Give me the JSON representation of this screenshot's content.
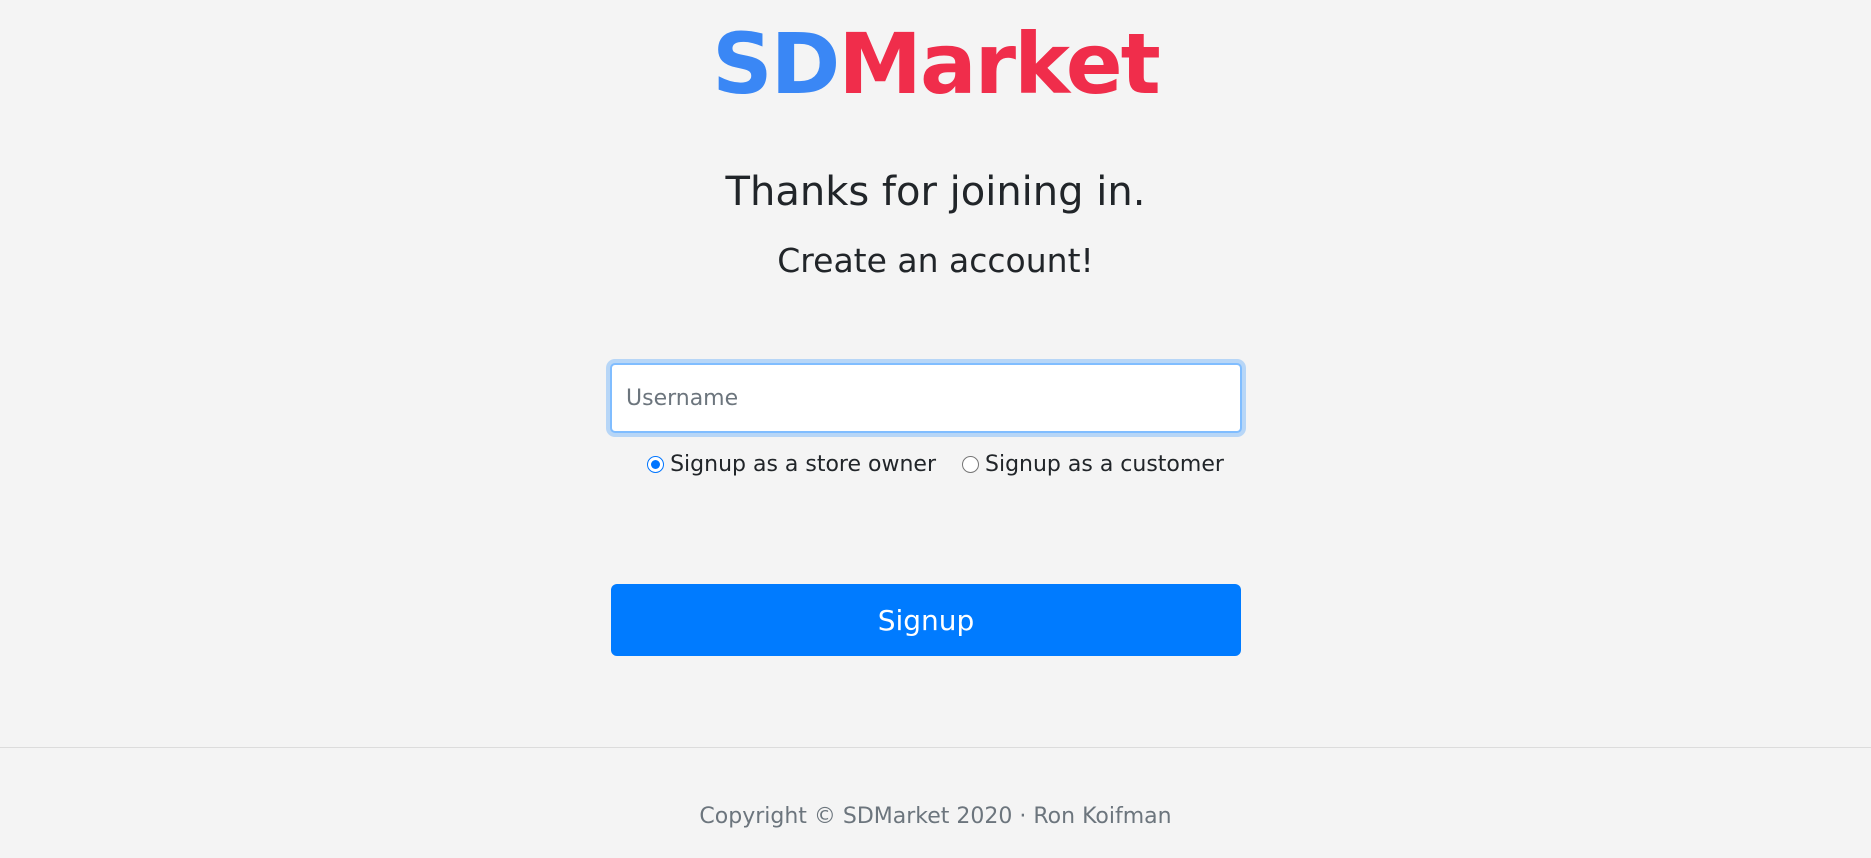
{
  "logo": {
    "part1": "SD",
    "part2": "Market",
    "part1_color": "#3a87f5",
    "part2_color": "#f02d4b"
  },
  "headings": {
    "thanks": "Thanks for joining in.",
    "create": "Create an account!"
  },
  "username": {
    "placeholder": "Username",
    "value": ""
  },
  "account_type": {
    "options": [
      {
        "label": "Signup as a store owner",
        "selected": true
      },
      {
        "label": "Signup as a customer",
        "selected": false
      }
    ]
  },
  "signup_button": {
    "label": "Signup",
    "color": "#007bff"
  },
  "footer": {
    "text": "Copyright © SDMarket 2020 · Ron Koifman"
  }
}
